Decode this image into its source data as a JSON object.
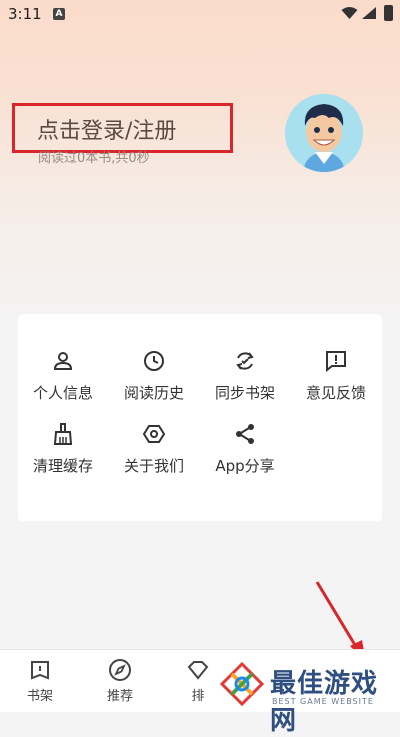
{
  "status_bar": {
    "time": "3:11",
    "notification_badge": "A"
  },
  "profile": {
    "login_label": "点击登录/注册",
    "reading_summary": "阅读过0本书,共0秒",
    "avatar_icon": "cartoon-boy-avatar"
  },
  "menu": [
    {
      "label": "个人信息",
      "icon": "person-icon"
    },
    {
      "label": "阅读历史",
      "icon": "clock-icon"
    },
    {
      "label": "同步书架",
      "icon": "sync-icon"
    },
    {
      "label": "意见反馈",
      "icon": "feedback-icon"
    },
    {
      "label": "清理缓存",
      "icon": "broom-icon"
    },
    {
      "label": "关于我们",
      "icon": "hexagon-icon"
    },
    {
      "label": "App分享",
      "icon": "share-icon"
    }
  ],
  "bottom_nav": [
    {
      "label": "书架",
      "icon": "bookshelf-icon"
    },
    {
      "label": "推荐",
      "icon": "compass-icon"
    },
    {
      "label": "排",
      "icon": "ranking-icon"
    }
  ],
  "watermark": {
    "title": "最佳游戏网",
    "subtitle": "BEST GAME WEBSITE"
  },
  "colors": {
    "highlight_box": "#d9262a",
    "arrow": "#d9262a",
    "watermark": "#2f4f80"
  }
}
